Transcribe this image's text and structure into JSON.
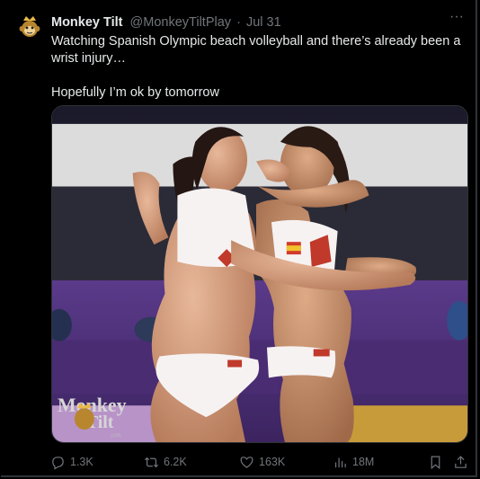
{
  "tweet": {
    "author_name": "Monkey Tilt",
    "author_handle": "@MonkeyTiltPlay",
    "separator": "·",
    "date": "Jul 31",
    "more_label": "···",
    "text_line1": "Watching Spanish Olympic beach volleyball and there’s already been a wrist injury…",
    "text_line2": "Hopefully I’m ok by tomorrow"
  },
  "media": {
    "watermark_line1": "Monkey",
    "watermark_line2": "Tilt",
    "watermark_small": ".com"
  },
  "actions": {
    "replies": "1.3K",
    "reposts": "6.2K",
    "likes": "163K",
    "views": "18M"
  },
  "icons": {
    "reply": "reply-icon",
    "repost": "repost-icon",
    "like": "heart-icon",
    "views": "views-icon",
    "bookmark": "bookmark-icon",
    "share": "share-icon"
  },
  "colors": {
    "background": "#000000",
    "text": "#e7e9ea",
    "muted": "#71767b",
    "border": "#2f3336"
  }
}
